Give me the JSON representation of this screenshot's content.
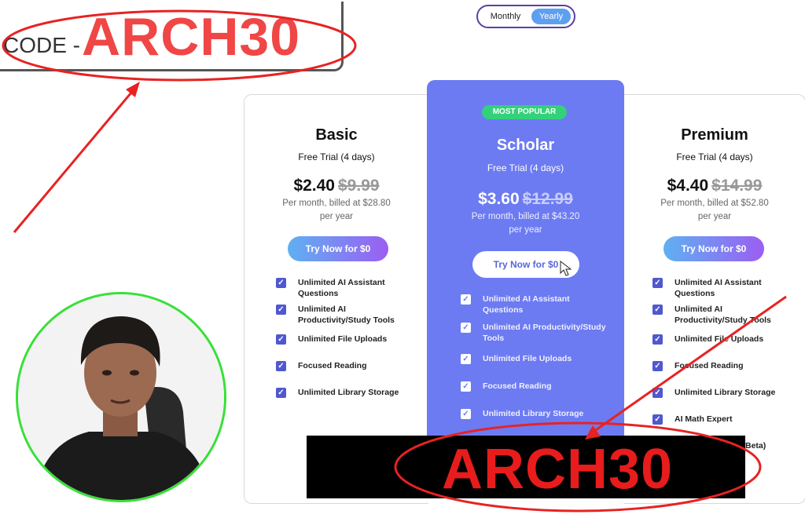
{
  "promo": {
    "code_prefix": "CODE -",
    "code": "ARCH30",
    "overlay_code": "ARCH30"
  },
  "billing_toggle": {
    "options": [
      "Monthly",
      "Yearly"
    ],
    "selected": "Yearly"
  },
  "plans": [
    {
      "name": "Basic",
      "trial": "Free Trial (4 days)",
      "price": "$2.40",
      "old_price": "$9.99",
      "billing_line1": "Per month, billed at $28.80",
      "billing_line2": "per year",
      "cta": "Try Now for $0",
      "features": [
        "Unlimited AI Assistant Questions",
        "Unlimited AI Productivity/Study Tools",
        "Unlimited File Uploads",
        "Focused Reading",
        "Unlimited Library Storage"
      ]
    },
    {
      "name": "Scholar",
      "badge": "MOST POPULAR",
      "trial": "Free Trial (4 days)",
      "price": "$3.60",
      "old_price": "$12.99",
      "billing_line1": "Per month, billed at $43.20",
      "billing_line2": "per year",
      "cta": "Try Now for $0",
      "features": [
        "Unlimited AI Assistant Questions",
        "Unlimited AI Productivity/Study Tools",
        "Unlimited File Uploads",
        "Focused Reading",
        "Unlimited Library Storage"
      ]
    },
    {
      "name": "Premium",
      "trial": "Free Trial (4 days)",
      "price": "$4.40",
      "old_price": "$14.99",
      "billing_line1": "Per month, billed at $52.80",
      "billing_line2": "per year",
      "cta": "Try Now for $0",
      "features": [
        "Unlimited AI Assistant Questions",
        "Unlimited AI Productivity/Study Tools",
        "Unlimited File Uploads",
        "Focused Reading",
        "Unlimited Library Storage",
        "AI Math Expert",
        "Beta)"
      ]
    }
  ],
  "colors": {
    "annotation_red": "#e82222",
    "scholar_bg": "#6c7bf2",
    "badge_green": "#33d17a",
    "webcam_ring": "#38e038"
  }
}
